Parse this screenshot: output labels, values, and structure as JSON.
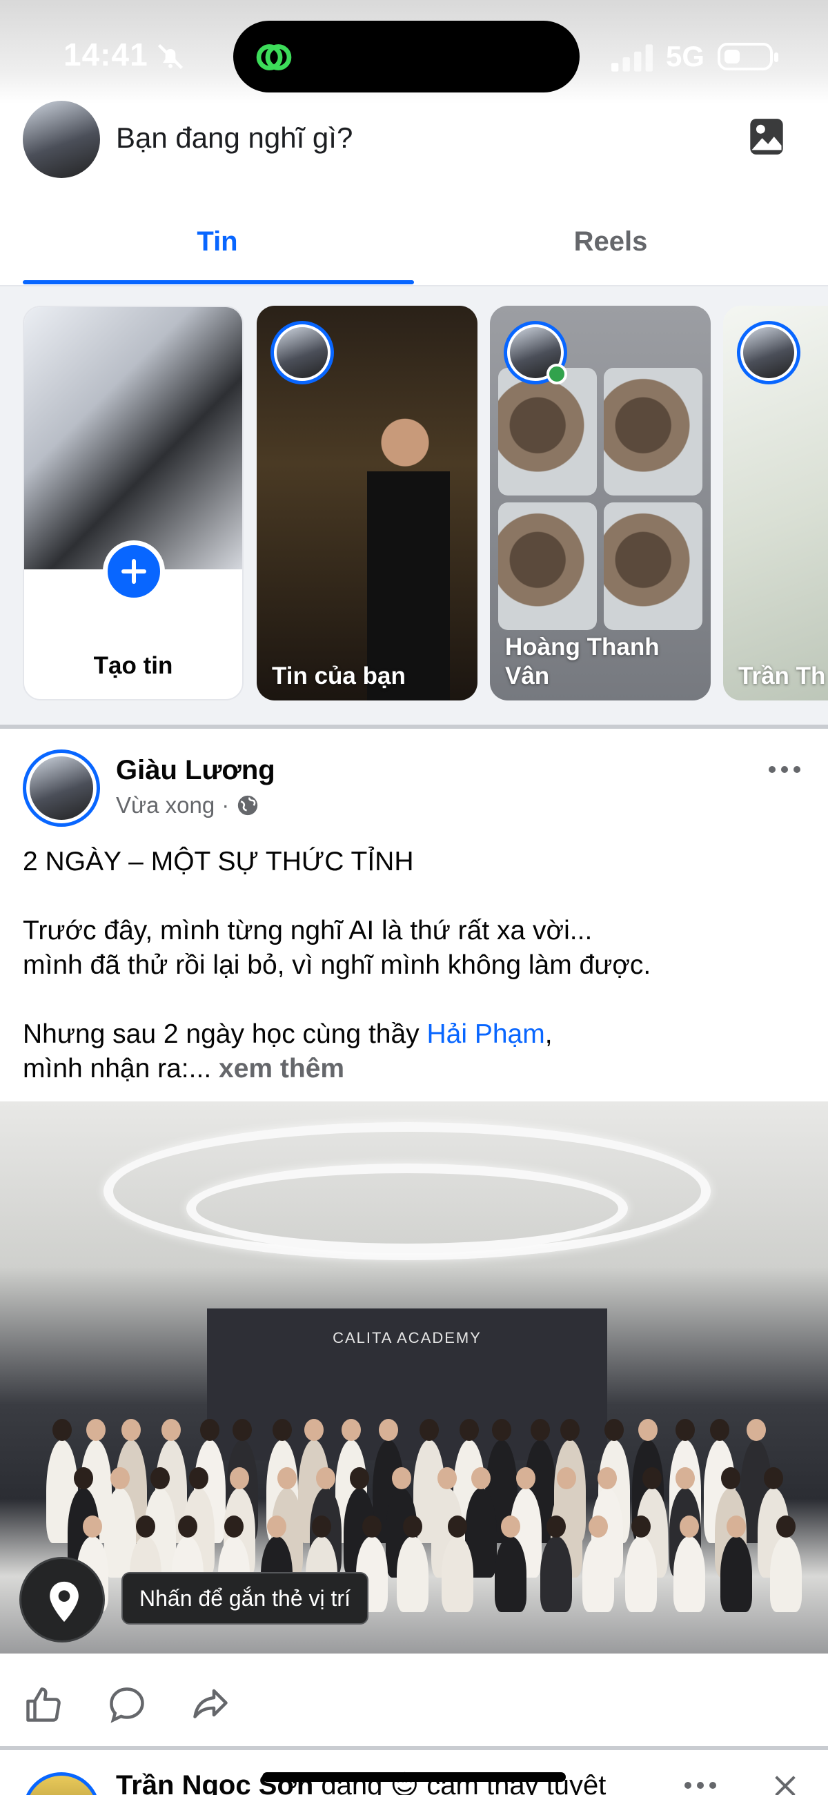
{
  "status_bar": {
    "time": "14:41",
    "network": "5G"
  },
  "composer": {
    "placeholder": "Bạn đang nghĩ gì?"
  },
  "tabs": [
    {
      "label": "Tin",
      "active": true
    },
    {
      "label": "Reels",
      "active": false
    }
  ],
  "stories": [
    {
      "label": "Tạo tin"
    },
    {
      "label": "Tin của bạn"
    },
    {
      "label": "Hoàng Thanh Vân"
    },
    {
      "label": "Trần Th"
    }
  ],
  "post": {
    "author": "Giàu Lương",
    "time": "Vừa xong",
    "separator": "·",
    "headline": "2 NGÀY – MỘT SỰ THỨC TỈNH",
    "paragraph1_line1": "Trước đây, mình từng nghĩ AI là thứ rất xa vời...",
    "paragraph1_line2": "mình đã thử rồi lại bỏ, vì nghĩ mình không làm được.",
    "paragraph2_line1_prefix": "Nhưng sau 2 ngày học cùng thầy ",
    "mention": "Hải Phạm",
    "paragraph2_line1_suffix": ",",
    "paragraph2_line2": "mình nhận ra:... ",
    "see_more": "xem thêm",
    "photo_backdrop": "CALITA ACADEMY",
    "location_tip": "Nhấn để gắn thẻ vị trí"
  },
  "next_post": {
    "author": "Trần Ngọc Sơn",
    "status": " đang 😊 cảm thấy tuyệt"
  },
  "colors": {
    "accent": "#0866ff",
    "online": "#31a24c",
    "text_secondary": "#65676b"
  },
  "icons": [
    "bell-off-icon",
    "island-app-icon",
    "signal-icon",
    "battery-icon",
    "photo-icon",
    "plus-icon",
    "globe-icon",
    "more-icon",
    "location-pin-icon",
    "like-icon",
    "comment-icon",
    "share-icon",
    "close-icon"
  ]
}
